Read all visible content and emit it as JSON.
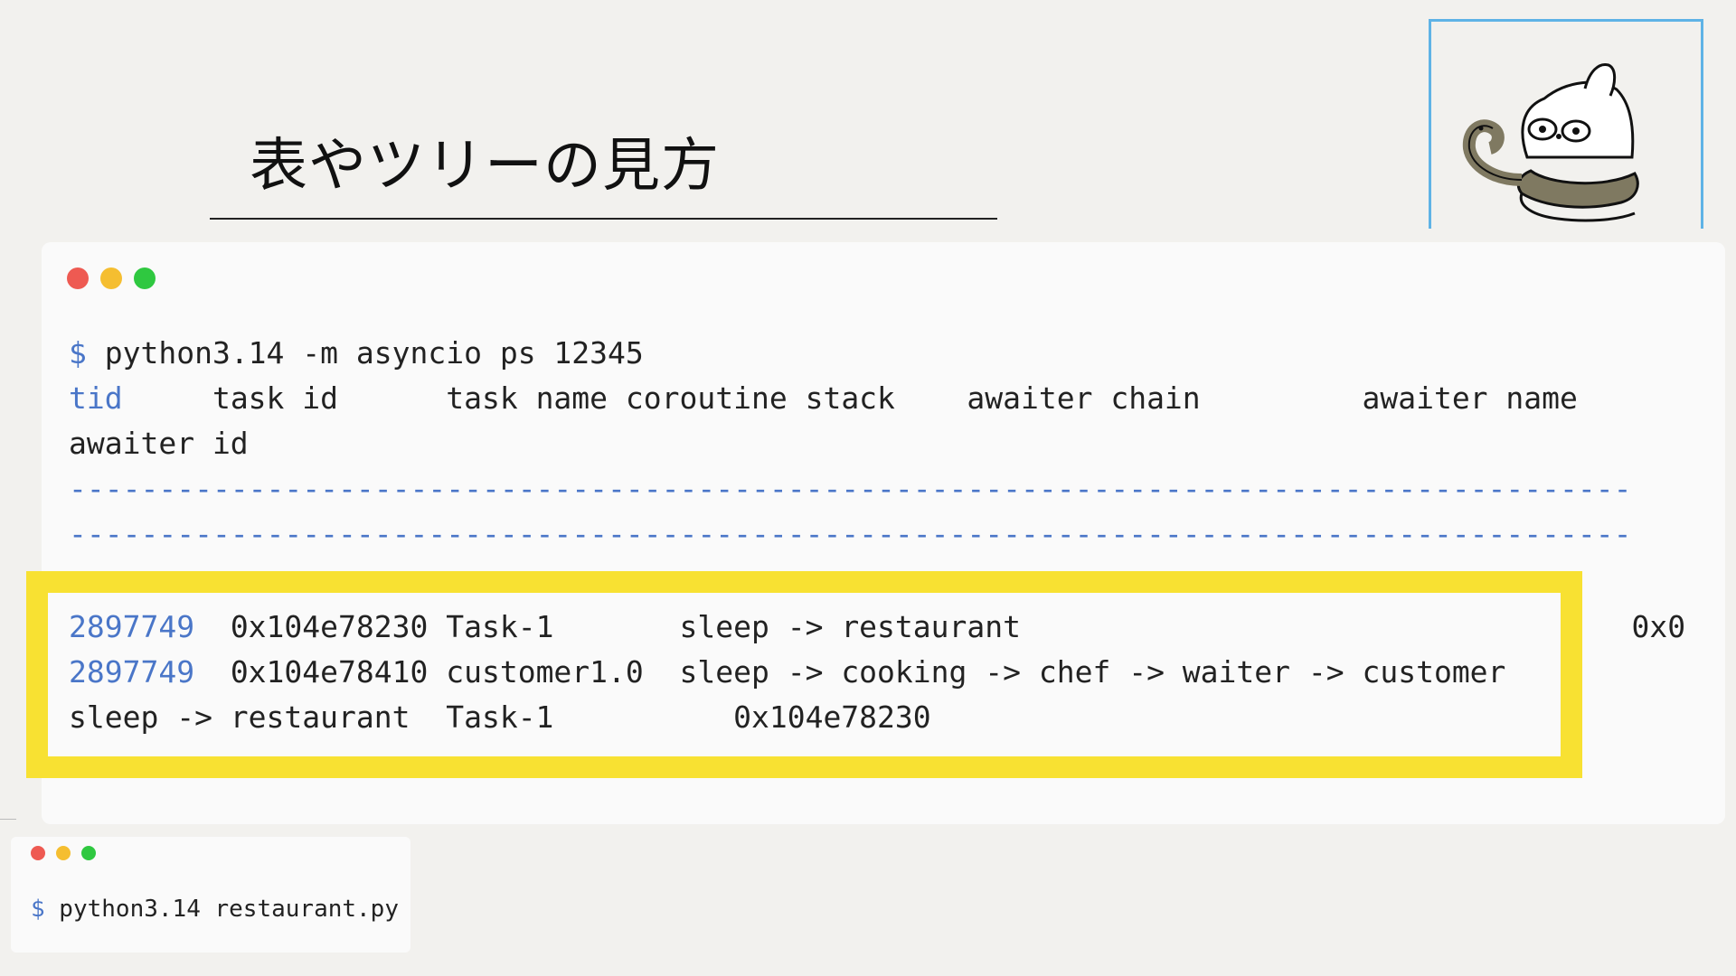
{
  "slide": {
    "title": "表やツリーの見方"
  },
  "terminal_main": {
    "prompt": "$",
    "command": " python3.14 -m asyncio ps 12345",
    "header_line1_tid": "tid",
    "header_line1_rest": "     task id      task name coroutine stack    awaiter chain         awaiter name",
    "header_line2": "awaiter id",
    "separator1": "---------------------------------------------------------------------------------------",
    "separator2": "---------------------------------------------------------------------------------------",
    "rows": [
      {
        "tid": "2897749",
        "rest": "  0x104e78230 Task-1       sleep -> restaurant                                  0x0"
      },
      {
        "tid": "2897749",
        "rest": "  0x104e78410 customer1.0  sleep -> cooking -> chef -> waiter -> customer"
      },
      {
        "tid": "",
        "rest": "sleep -> restaurant  Task-1          0x104e78230"
      }
    ]
  },
  "terminal_small": {
    "prompt": "$",
    "command": " python3.14 restaurant.py"
  },
  "colors": {
    "highlight": "#f8e132",
    "prompt_blue": "#4a76c8",
    "frame_blue": "#5fb3e6"
  },
  "icons": [
    "mascot-illustration",
    "window-close-dot",
    "window-minimize-dot",
    "window-zoom-dot"
  ]
}
